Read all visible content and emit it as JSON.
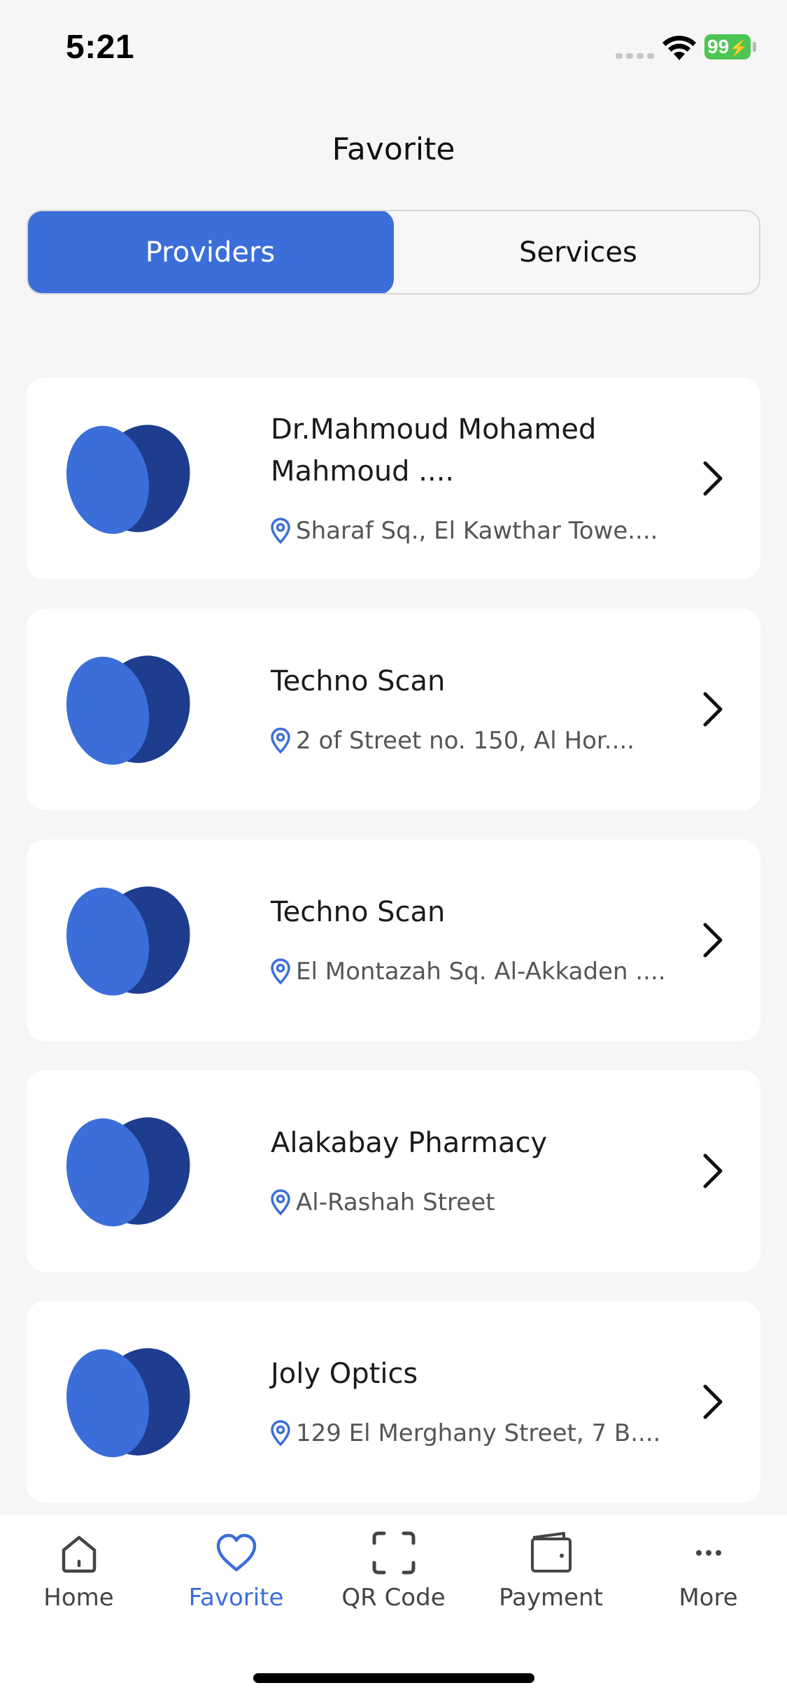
{
  "status_bar": {
    "time": "5:21",
    "battery": "99"
  },
  "header": {
    "title": "Favorite"
  },
  "segments": {
    "providers": "Providers",
    "services": "Services",
    "active": "Providers"
  },
  "providers": [
    {
      "name_line1": "Dr.Mahmoud Mohamed",
      "name_line2": "Mahmoud ....",
      "address": "Sharaf Sq., El Kawthar Towe...."
    },
    {
      "name_line1": "Techno Scan",
      "address": "2 of Street no. 150, Al Hor...."
    },
    {
      "name_line1": "Techno Scan",
      "address": "El Montazah Sq. Al-Akkaden ...."
    },
    {
      "name_line1": "Alakabay Pharmacy",
      "address": "Al-Rashah Street"
    },
    {
      "name_line1": "Joly Optics",
      "address": "129 El Merghany Street, 7 B...."
    }
  ],
  "tab_bar": {
    "home": "Home",
    "favorite": "Favorite",
    "qr_code": "QR Code",
    "payment": "Payment",
    "more": "More",
    "active": "Favorite"
  },
  "colors": {
    "accent": "#3b6ed9",
    "logo_light": "#3b6ed9",
    "logo_dark": "#1e3d8f",
    "battery": "#4cc552"
  },
  "icons": {
    "provider_logo": "leaf-logo-icon",
    "address": "location-pin-icon",
    "row_action": "chevron-right-icon",
    "home": "house-icon",
    "favorite": "heart-icon",
    "qr_code": "scan-frame-icon",
    "payment": "wallet-icon",
    "more": "ellipsis-icon"
  }
}
